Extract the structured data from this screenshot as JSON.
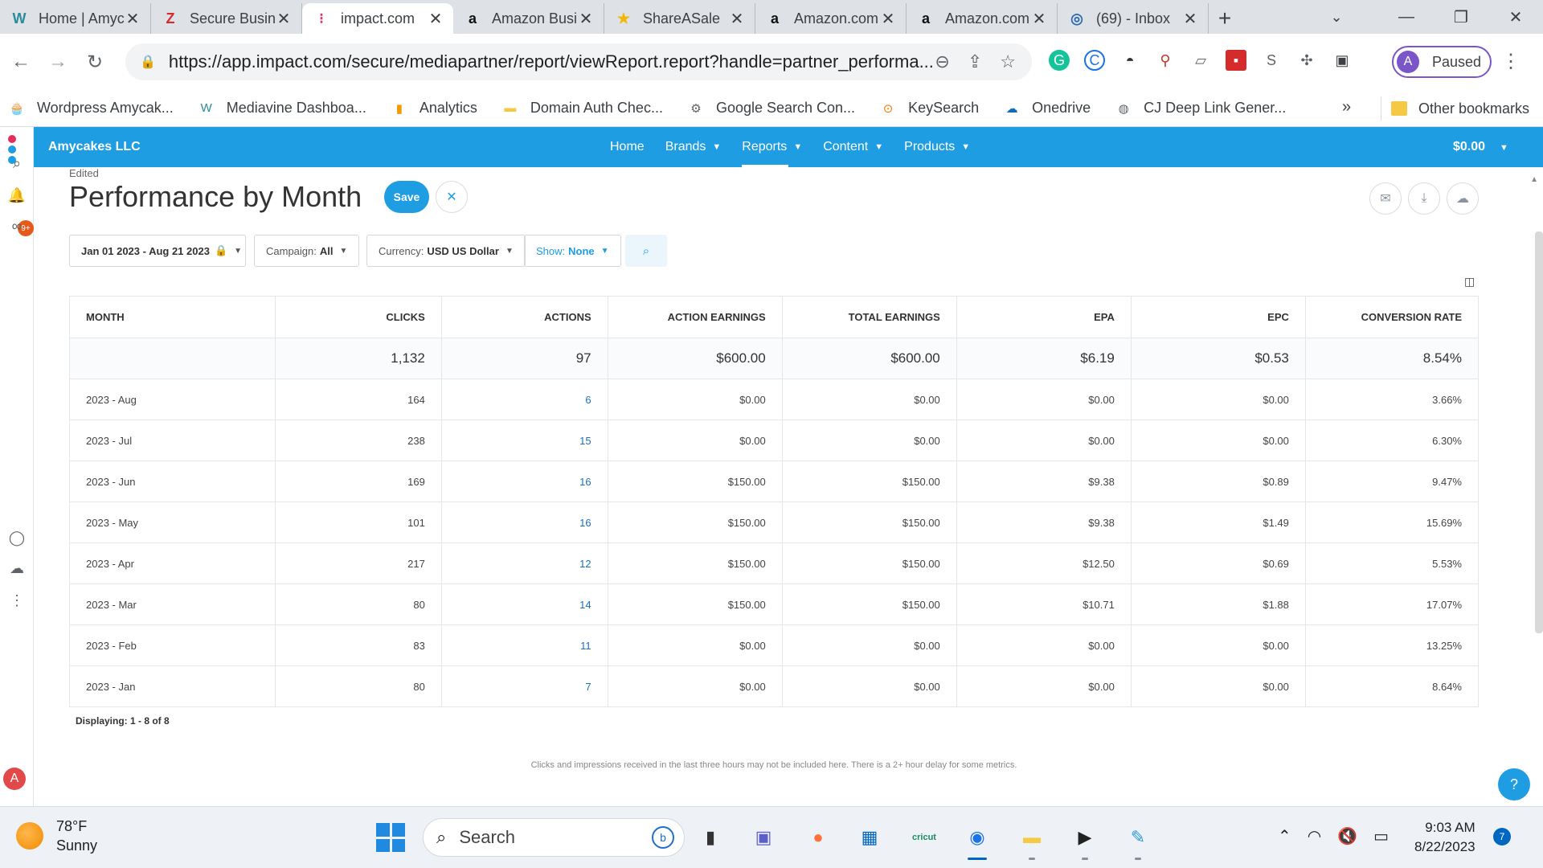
{
  "browser": {
    "tabs": [
      {
        "title": "Home | Amycakes",
        "icon": "mediavine-icon",
        "color": "#2a8c9a",
        "glyph": "W",
        "active": false
      },
      {
        "title": "Secure Business",
        "icon": "zoho-icon",
        "color": "#d62b2b",
        "glyph": "Z",
        "active": false
      },
      {
        "title": "impact.com",
        "icon": "impact-icon",
        "color": "#e52d5b",
        "glyph": "⁝",
        "active": true
      },
      {
        "title": "Amazon Business",
        "icon": "amazon-icon",
        "color": "#111111",
        "glyph": "a",
        "active": false
      },
      {
        "title": "ShareASale",
        "icon": "shareasale-icon",
        "color": "#f2b705",
        "glyph": "★",
        "active": false
      },
      {
        "title": "Amazon.com",
        "icon": "amazon-icon",
        "color": "#111111",
        "glyph": "a",
        "active": false
      },
      {
        "title": "Amazon.com",
        "icon": "amazon-icon",
        "color": "#111111",
        "glyph": "a",
        "active": false
      },
      {
        "title": "(69) - Inbox",
        "icon": "inbox-icon",
        "color": "#2b6cb0",
        "glyph": "◎",
        "active": false
      }
    ],
    "new_tab": "+",
    "url": "https://app.impact.com/secure/mediapartner/report/viewReport.report?handle=partner_performa...",
    "profile_initial": "A",
    "profile_status": "Paused",
    "bookmarks": [
      {
        "label": "Wordpress Amycak...",
        "icon": "cupcake-icon",
        "color": "#c0392b",
        "glyph": "🧁"
      },
      {
        "label": "Mediavine Dashboa...",
        "icon": "mediavine-icon",
        "color": "#2a8c9a",
        "glyph": "W"
      },
      {
        "label": "Analytics",
        "icon": "analytics-icon",
        "color": "#f29900",
        "glyph": "▮"
      },
      {
        "label": "Domain Auth Chec...",
        "icon": "folder-icon",
        "color": "#f6c945",
        "glyph": "▬"
      },
      {
        "label": "Google Search Con...",
        "icon": "search-console-icon",
        "color": "#5f6368",
        "glyph": "⚙"
      },
      {
        "label": "KeySearch",
        "icon": "keysearch-icon",
        "color": "#f07800",
        "glyph": "⊙"
      },
      {
        "label": "Onedrive",
        "icon": "cloud-icon",
        "color": "#0f6cbd",
        "glyph": "☁"
      },
      {
        "label": "CJ Deep Link Gener...",
        "icon": "globe-icon",
        "color": "#5f6368",
        "glyph": "◍"
      }
    ],
    "bookmarks_more": "»",
    "other_bookmarks": "Other bookmarks"
  },
  "app": {
    "company": "Amycakes LLC",
    "nav": [
      {
        "label": "Home",
        "dropdown": false
      },
      {
        "label": "Brands",
        "dropdown": true
      },
      {
        "label": "Reports",
        "dropdown": true,
        "active": true
      },
      {
        "label": "Content",
        "dropdown": true
      },
      {
        "label": "Products",
        "dropdown": true
      }
    ],
    "balance": "$0.00",
    "notifications_badge": "9+",
    "user_initial": "A"
  },
  "report": {
    "status": "Edited",
    "title": "Performance by Month",
    "save_label": "Save",
    "filters": {
      "date_range": "Jan 01 2023 - Aug 21 2023",
      "campaign_label": "Campaign:",
      "campaign_value": "All",
      "currency_label": "Currency:",
      "currency_value": "USD US Dollar",
      "show_label": "Show:",
      "show_value": "None"
    },
    "columns": [
      "MONTH",
      "CLICKS",
      "ACTIONS",
      "ACTION EARNINGS",
      "TOTAL EARNINGS",
      "EPA",
      "EPC",
      "CONVERSION RATE"
    ],
    "totals": [
      "",
      "1,132",
      "97",
      "$600.00",
      "$600.00",
      "$6.19",
      "$0.53",
      "8.54%"
    ],
    "rows": [
      [
        "2023 - Aug",
        "164",
        "6",
        "$0.00",
        "$0.00",
        "$0.00",
        "$0.00",
        "3.66%"
      ],
      [
        "2023 - Jul",
        "238",
        "15",
        "$0.00",
        "$0.00",
        "$0.00",
        "$0.00",
        "6.30%"
      ],
      [
        "2023 - Jun",
        "169",
        "16",
        "$150.00",
        "$150.00",
        "$9.38",
        "$0.89",
        "9.47%"
      ],
      [
        "2023 - May",
        "101",
        "16",
        "$150.00",
        "$150.00",
        "$9.38",
        "$1.49",
        "15.69%"
      ],
      [
        "2023 - Apr",
        "217",
        "12",
        "$150.00",
        "$150.00",
        "$12.50",
        "$0.69",
        "5.53%"
      ],
      [
        "2023 - Mar",
        "80",
        "14",
        "$150.00",
        "$150.00",
        "$10.71",
        "$1.88",
        "17.07%"
      ],
      [
        "2023 - Feb",
        "83",
        "11",
        "$0.00",
        "$0.00",
        "$0.00",
        "$0.00",
        "13.25%"
      ],
      [
        "2023 - Jan",
        "80",
        "7",
        "$0.00",
        "$0.00",
        "$0.00",
        "$0.00",
        "8.64%"
      ]
    ],
    "displaying": "Displaying: 1 - 8 of 8",
    "footnote": "Clicks and impressions received in the last three hours may not be included here. There is a 2+ hour delay for some metrics."
  },
  "taskbar": {
    "temperature": "78°F",
    "condition": "Sunny",
    "search_placeholder": "Search",
    "apps": [
      {
        "name": "file-manager-icon",
        "glyph": "▮",
        "color": "#333333",
        "running": false
      },
      {
        "name": "teams-icon",
        "glyph": "▣",
        "color": "#5b5fc7",
        "running": false
      },
      {
        "name": "firefox-icon",
        "glyph": "●",
        "color": "#ff7139",
        "running": false
      },
      {
        "name": "store-icon",
        "glyph": "▦",
        "color": "#0067c0",
        "running": false
      },
      {
        "name": "cricut-icon",
        "glyph": "cricut",
        "color": "#1a8d5f",
        "running": false
      },
      {
        "name": "chrome-icon",
        "glyph": "◉",
        "color": "#1a73e8",
        "running": true,
        "active": true
      },
      {
        "name": "folder-icon",
        "glyph": "▬",
        "color": "#f6c945",
        "running": true
      },
      {
        "name": "media-player-icon",
        "glyph": "▶",
        "color": "#222222",
        "running": true
      },
      {
        "name": "paint-icon",
        "glyph": "✎",
        "color": "#2b9bd8",
        "running": true
      }
    ],
    "time": "9:03 AM",
    "date": "8/22/2023",
    "notification_count": "7"
  }
}
